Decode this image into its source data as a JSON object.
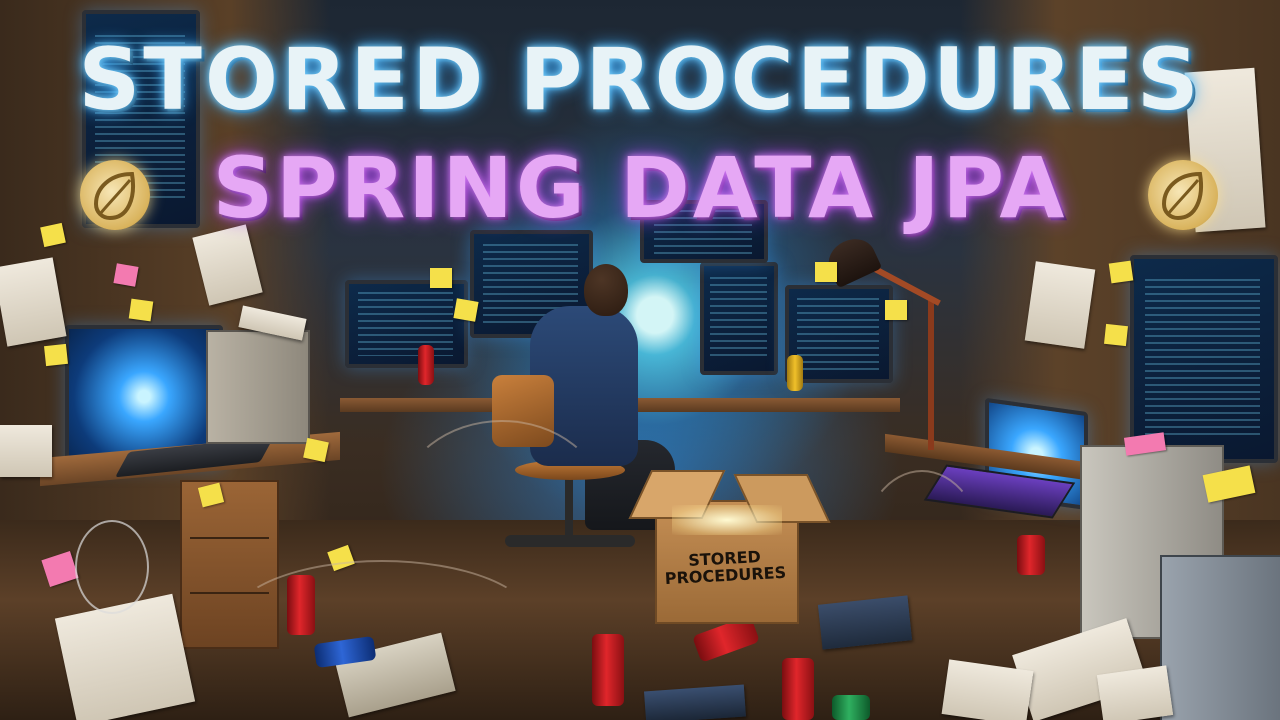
{
  "image": {
    "title_line_1": "STORED PROCEDURES",
    "title_line_2": "SPRING DATA JPA",
    "box_label": "STORED PROCEDURES",
    "colors": {
      "title_line_1": "#e8f3f7",
      "title_line_1_glow": "#38aaff",
      "title_line_2": "#e6a8f5",
      "title_line_2_glow": "#9e3ee0",
      "screen_glow": "#50dcff",
      "spring_logo": "#d9b35c"
    },
    "icons": [
      "spring-leaf-logo-left",
      "spring-leaf-logo-right"
    ]
  }
}
